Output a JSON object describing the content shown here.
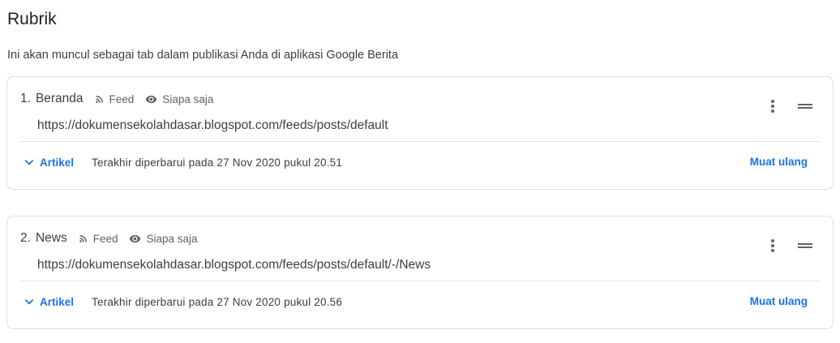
{
  "page": {
    "title": "Rubrik",
    "description": "Ini akan muncul sebagai tab dalam publikasi Anda di aplikasi Google Berita"
  },
  "sections": [
    {
      "number": "1.",
      "name": "Beranda",
      "type_label": "Feed",
      "type_icon": "rss-icon",
      "visibility_label": "Siapa saja",
      "visibility_icon": "eye-icon",
      "url": "https://dokumensekolahdasar.blogspot.com/feeds/posts/default",
      "expand_label": "Artikel",
      "updated": "Terakhir diperbarui pada 27 Nov 2020 pukul 20.51",
      "reload_label": "Muat ulang"
    },
    {
      "number": "2.",
      "name": "News",
      "type_label": "Feed",
      "type_icon": "rss-icon",
      "visibility_label": "Siapa saja",
      "visibility_icon": "eye-icon",
      "url": "https://dokumensekolahdasar.blogspot.com/feeds/posts/default/-/News",
      "expand_label": "Artikel",
      "updated": "Terakhir diperbarui pada 27 Nov 2020 pukul 20.56",
      "reload_label": "Muat ulang"
    }
  ],
  "colors": {
    "accent": "#1a73e8",
    "text": "#202124",
    "secondary_text": "#5f6368",
    "border": "#dadce0"
  }
}
